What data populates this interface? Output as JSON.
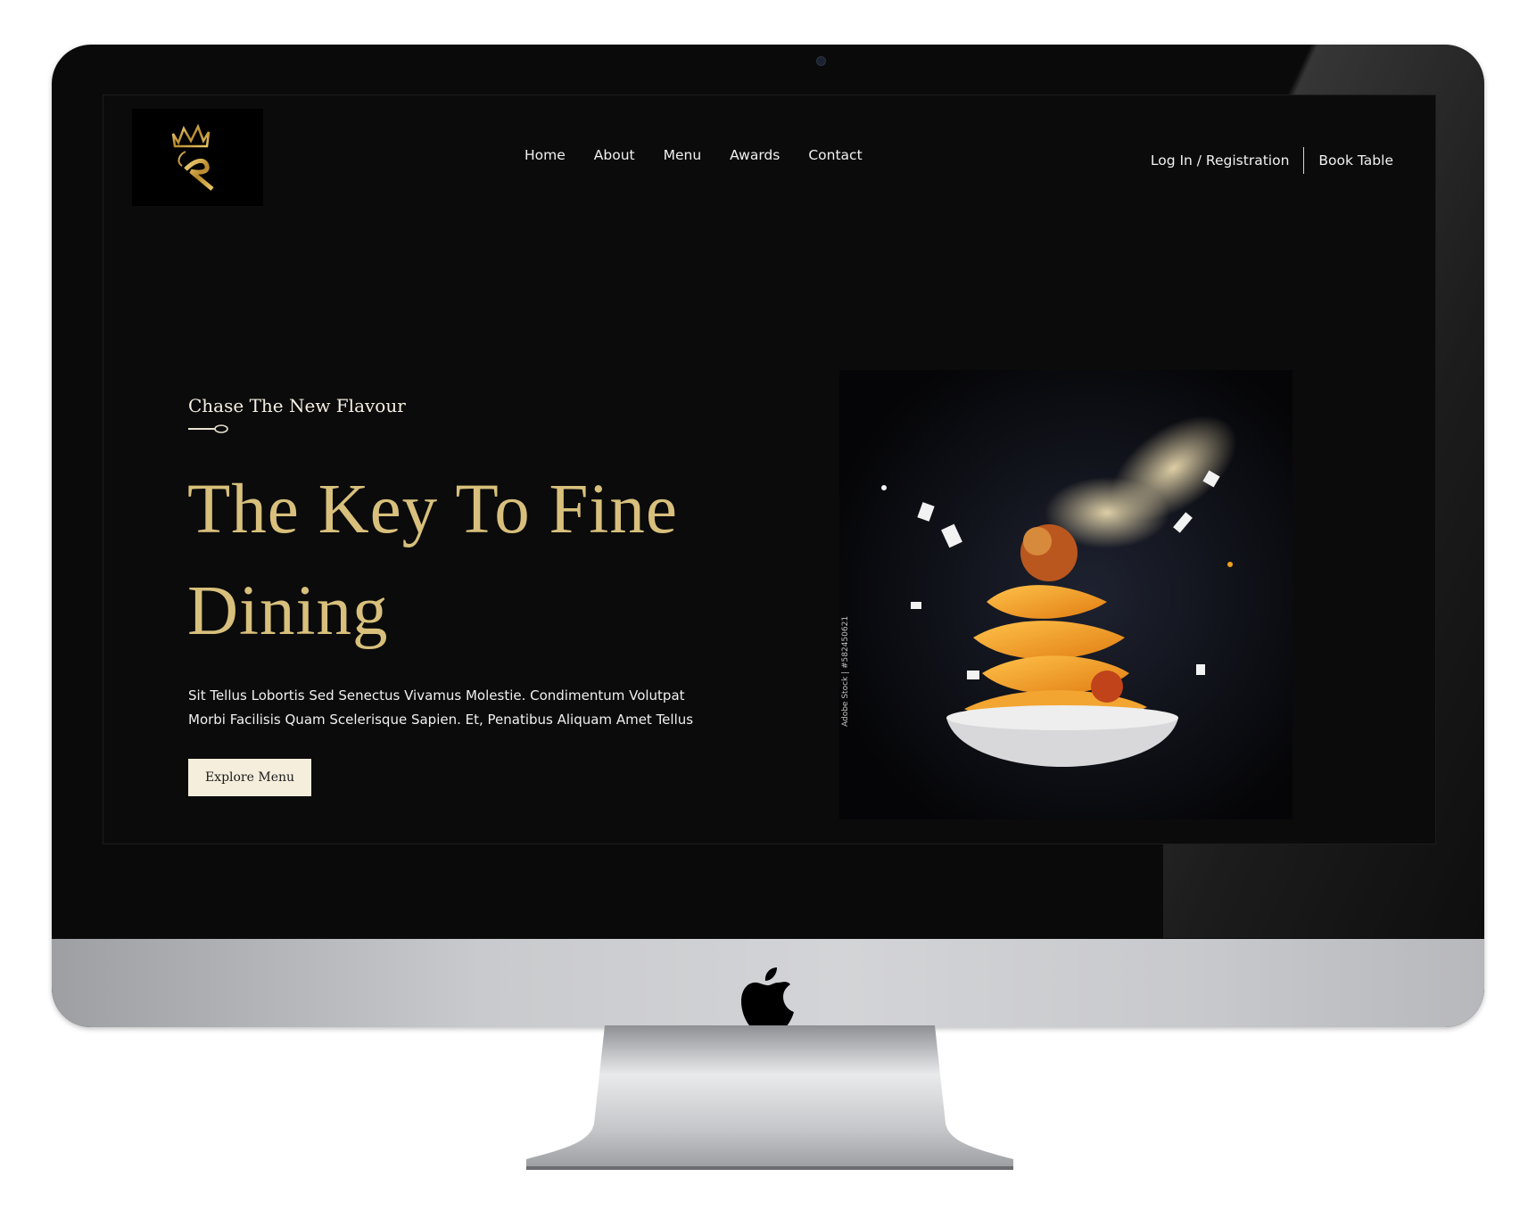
{
  "site": {
    "nav": [
      "Home",
      "About",
      "Menu",
      "Awards",
      "Contact"
    ],
    "auth": {
      "login": "Log In / Registration",
      "book": "Book Table"
    }
  },
  "hero": {
    "tagline": "Chase The New Flavour",
    "headline_line1": "The Key To Fine",
    "headline_line2": "Dining",
    "description_line1": "Sit Tellus Lobortis Sed Senectus Vivamus Molestie. Condimentum Volutpat",
    "description_line2": "Morbi Facilisis Quam Scelerisque Sapien. Et, Penatibus Aliquam Amet Tellus",
    "cta": "Explore Menu",
    "image_watermark": "Adobe Stock | #582450621"
  },
  "colors": {
    "background": "#0b0b0b",
    "gold": "#d8c07c",
    "button_bg": "#f5eedc"
  },
  "icons": [
    "crown-k-logo",
    "spoon-icon",
    "apple-logo"
  ]
}
